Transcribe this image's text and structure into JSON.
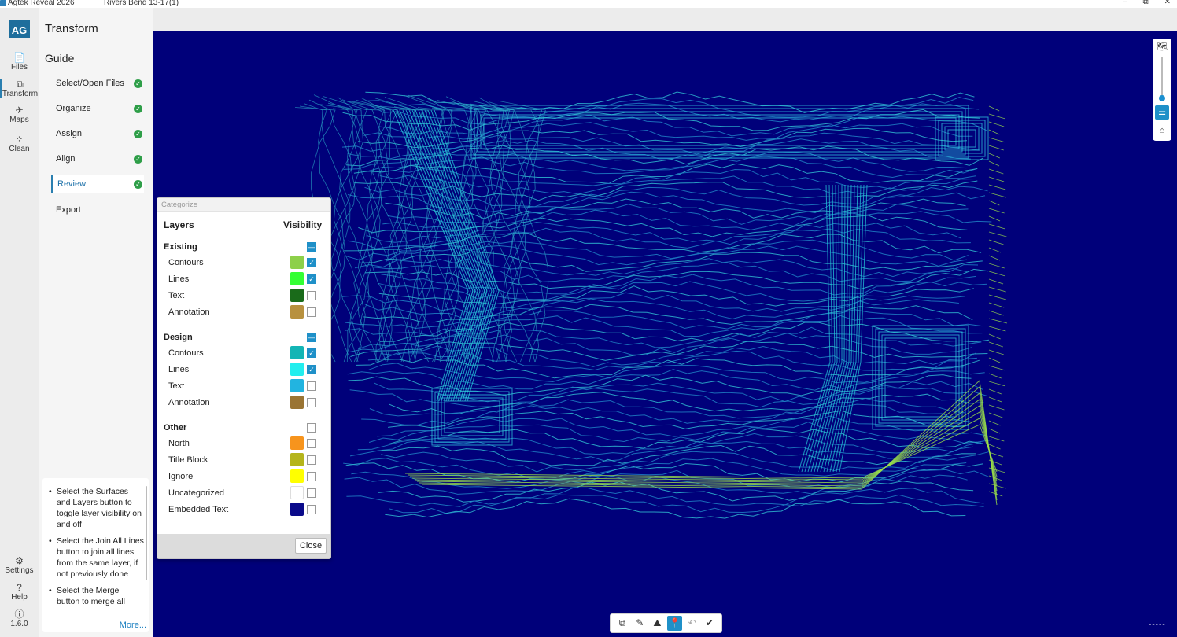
{
  "window": {
    "app_title": "Agtek Reveal 2026",
    "document_title": "Rivers Bend 13-17(1)",
    "min": "–",
    "max": "⧉",
    "close": "✕"
  },
  "rail": {
    "logo": "AG",
    "items": [
      {
        "label": "Files",
        "icon": "📄"
      },
      {
        "label": "Transform",
        "icon": "⧉"
      },
      {
        "label": "Maps",
        "icon": "✈"
      },
      {
        "label": "Clean",
        "icon": "⁘"
      }
    ],
    "settings": {
      "label": "Settings",
      "icon": "⚙"
    },
    "help": {
      "label": "Help",
      "icon": "?"
    },
    "version": {
      "label": "1.6.0",
      "icon": "ⓘ"
    }
  },
  "guide": {
    "title": "Transform",
    "subtitle": "Guide",
    "steps": [
      {
        "label": "Select/Open Files",
        "done": "✓"
      },
      {
        "label": "Organize",
        "done": "✓"
      },
      {
        "label": "Assign",
        "done": "✓"
      },
      {
        "label": "Align",
        "done": "✓"
      },
      {
        "label": "Review",
        "done": "✓"
      },
      {
        "label": "Export"
      }
    ],
    "tips": [
      "Select the Surfaces and Layers button to toggle layer visibility on and off",
      "Select the Join All Lines button to join all lines from the same layer, if not previously done",
      "Select the Merge button to merge all"
    ],
    "more": "More..."
  },
  "dialog": {
    "title": "Categorize",
    "col_layers": "Layers",
    "col_visibility": "Visibility",
    "groups": {
      "existing": {
        "name": "Existing",
        "rows": [
          {
            "label": "Contours",
            "color": "#8dd04a",
            "visible": true
          },
          {
            "label": "Lines",
            "color": "#33ff33",
            "visible": true
          },
          {
            "label": "Text",
            "color": "#1a6b1a",
            "visible": false
          },
          {
            "label": "Annotation",
            "color": "#b8913f",
            "visible": false
          }
        ]
      },
      "design": {
        "name": "Design",
        "rows": [
          {
            "label": "Contours",
            "color": "#13b5b5",
            "visible": true
          },
          {
            "label": "Lines",
            "color": "#22eeee",
            "visible": true
          },
          {
            "label": "Text",
            "color": "#22b4e0",
            "visible": false
          },
          {
            "label": "Annotation",
            "color": "#9a7433",
            "visible": false
          }
        ]
      },
      "other": {
        "name": "Other",
        "rows": [
          {
            "label": "North",
            "color": "#f7941d",
            "visible": false
          },
          {
            "label": "Title Block",
            "color": "#b5b51c",
            "visible": false
          },
          {
            "label": "Ignore",
            "color": "#ffff00",
            "visible": false
          },
          {
            "label": "Uncategorized",
            "color": "#ffffff",
            "visible": false
          },
          {
            "label": "Embedded Text",
            "color": "#0a0a8a",
            "visible": false
          }
        ]
      }
    },
    "close": "Close"
  },
  "map": {
    "background": "#00007a",
    "scale_label": "-----"
  },
  "zoom": {
    "top_icon": "🗺",
    "list_icon": "☰",
    "home_icon": "⌂",
    "level_fraction": 0.8
  },
  "toolbar": {
    "items": [
      {
        "name": "copy-layers",
        "icon": "⧉"
      },
      {
        "name": "join-lines",
        "icon": "✎"
      },
      {
        "name": "surfaces",
        "icon": "⛰"
      },
      {
        "name": "pin",
        "icon": "📍"
      },
      {
        "name": "undo",
        "icon": "↶"
      },
      {
        "name": "done",
        "icon": "✔"
      }
    ]
  }
}
